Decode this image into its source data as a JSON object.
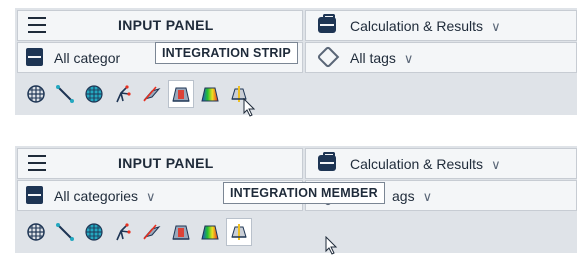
{
  "screens": [
    {
      "menu_icon": "hamburger-icon",
      "panel_title": "INPUT PANEL",
      "calc_label": "Calculation & Results",
      "category_label": "All categor",
      "tags_label": "All tags",
      "tooltip": "INTEGRATION STRIP",
      "active_tool": 5
    },
    {
      "menu_icon": "hamburger-icon",
      "panel_title": "INPUT PANEL",
      "calc_label": "Calculation & Results",
      "category_label": "All categories",
      "tags_label": "ags",
      "tooltip": "INTEGRATION MEMBER",
      "active_tool": 8
    }
  ],
  "chevron_glyph": "∨",
  "tools": [
    "grid-sphere-icon",
    "line-member-icon",
    "mesh-sphere-icon",
    "branch-tree-icon",
    "plate-icon",
    "integration-strip-icon",
    "colored-strip-icon",
    "integration-member-icon"
  ],
  "colors": {
    "accent_dark": "#1e3554",
    "panel_bg": "#dfe3e8",
    "row_bg": "#f4f6f8",
    "rainbow": [
      "#2050d8",
      "#24c030",
      "#f0e020",
      "#e83020"
    ]
  }
}
